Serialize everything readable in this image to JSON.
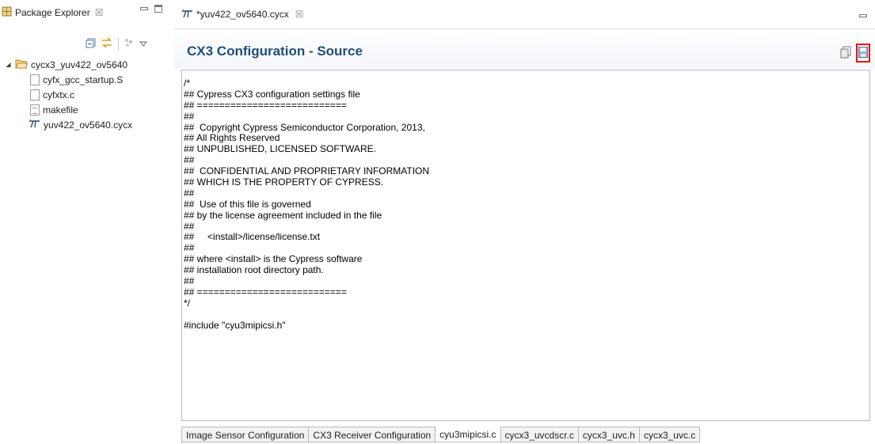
{
  "package_explorer": {
    "title": "Package Explorer",
    "close_glyph": "☒",
    "icons": [
      "package-explorer-icon",
      "collapse-all-icon",
      "link-with-editor-icon",
      "filter-icon",
      "view-menu-icon",
      "minimize-icon",
      "maximize-icon"
    ],
    "tree": {
      "project": "cycx3_yuv422_ov5640",
      "children": [
        {
          "label": "cyfx_gcc_startup.S",
          "icon": "file-icon"
        },
        {
          "label": "cyfxtx.c",
          "icon": "file-icon"
        },
        {
          "label": "makefile",
          "icon": "makefile-icon"
        },
        {
          "label": "yuv422_ov5640.cycx",
          "icon": "cycx-config-icon"
        }
      ]
    }
  },
  "editor": {
    "tab_title": "*yuv422_ov5640.cycx",
    "close_glyph": "☒",
    "header_title": "CX3 Configuration - Source",
    "source_lines": [
      "/*",
      "## Cypress CX3 configuration settings file",
      "## ===========================",
      "##",
      "##  Copyright Cypress Semiconductor Corporation, 2013,",
      "## All Rights Reserved",
      "## UNPUBLISHED, LICENSED SOFTWARE.",
      "##",
      "##  CONFIDENTIAL AND PROPRIETARY INFORMATION",
      "## WHICH IS THE PROPERTY OF CYPRESS.",
      "##",
      "##  Use of this file is governed",
      "## by the license agreement included in the file",
      "##",
      "##     <install>/license/license.txt",
      "##",
      "## where <install> is the Cypress software",
      "## installation root directory path.",
      "##",
      "## ===========================",
      "*/",
      "",
      "#include \"cyu3mipicsi.h\""
    ],
    "bottom_tabs": [
      {
        "label": "Image Sensor Configuration",
        "active": false
      },
      {
        "label": "CX3 Receiver Configuration",
        "active": false
      },
      {
        "label": "cyu3mipicsi.c",
        "active": true
      },
      {
        "label": "cycx3_uvcdscr.c",
        "active": false
      },
      {
        "label": "cycx3_uvc.h",
        "active": false
      },
      {
        "label": "cycx3_uvc.c",
        "active": false
      }
    ]
  },
  "colors": {
    "header_title": "#1f4e79",
    "save_highlight": "#e01515",
    "folder": "#e8c36a"
  }
}
